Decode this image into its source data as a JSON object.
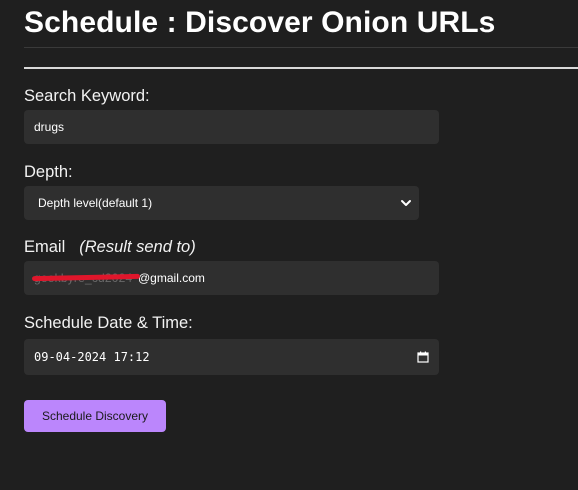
{
  "page": {
    "title": "Schedule : Discover Onion URLs"
  },
  "form": {
    "keyword": {
      "label": "Search Keyword:",
      "value": "drugs"
    },
    "depth": {
      "label": "Depth:",
      "selected": "Depth level(default 1)"
    },
    "email": {
      "label": "Email",
      "hint": "(Result send to)",
      "redacted_part": "geekbyre_cd2024",
      "visible_suffix": "@gmail.com"
    },
    "schedule": {
      "label": "Schedule Date & Time:",
      "date": "09-04-2024",
      "time": "17:12"
    },
    "submit_label": "Schedule Discovery"
  },
  "colors": {
    "background": "#1f1f1f",
    "field_background": "#2f2f2f",
    "accent": "#bb86fc",
    "redaction": "#e0162b"
  },
  "icons": {
    "depth_dropdown": "chevron-down-icon",
    "datetime_picker": "calendar-icon"
  }
}
